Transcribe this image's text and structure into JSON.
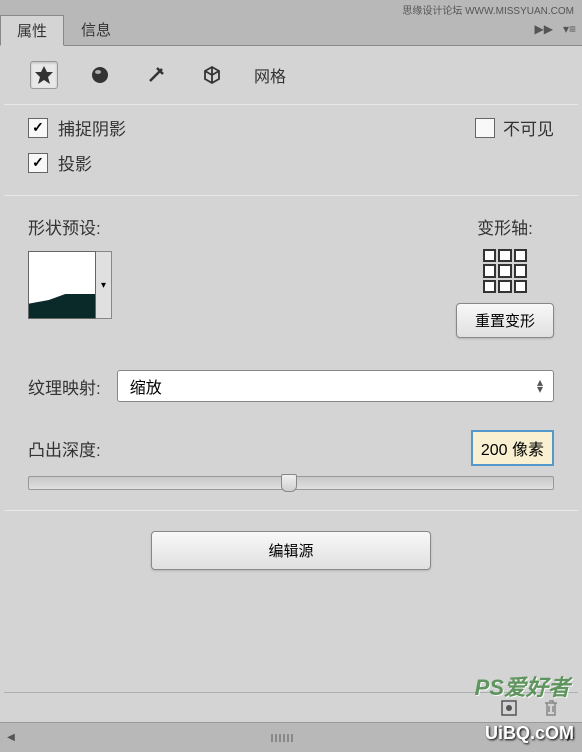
{
  "header": {
    "source": "思缘设计论坛  WWW.MISSYUAN.COM"
  },
  "tabs": {
    "properties": "属性",
    "info": "信息"
  },
  "toolbar": {
    "mesh_label": "网格"
  },
  "checkboxes": {
    "capture_shadow": "捕捉阴影",
    "cast_shadow": "投影",
    "invisible": "不可见"
  },
  "preset": {
    "shape_label": "形状预设:",
    "deform_label": "变形轴:",
    "reset_button": "重置变形"
  },
  "texture": {
    "label": "纹理映射:",
    "value": "缩放"
  },
  "depth": {
    "label": "凸出深度:",
    "value": "200 像素"
  },
  "edit": {
    "button": "编辑源"
  },
  "watermark": {
    "top": "PS爱好者",
    "bottom": "UiBQ.cOM"
  }
}
